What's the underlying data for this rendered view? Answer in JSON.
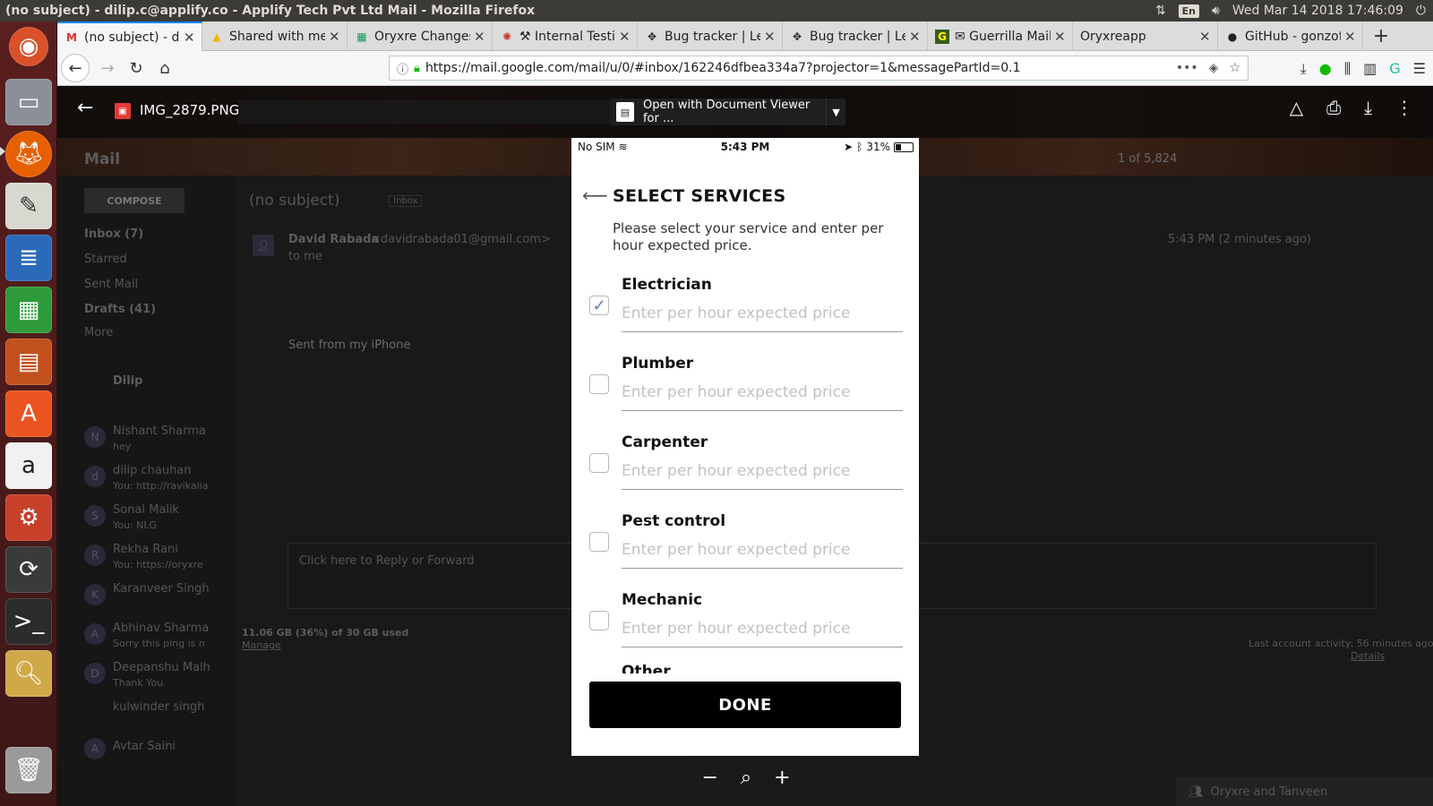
{
  "panel": {
    "window_title": "(no subject) - dilip.c@applify.co - Applify Tech Pvt Ltd Mail - Mozilla Firefox",
    "lang": "En",
    "datetime": "Wed Mar 14 2018 17:46:09"
  },
  "tabs": [
    {
      "label": "(no subject) - dil",
      "icon": "gmail-icon",
      "active": true
    },
    {
      "label": "Shared with me",
      "icon": "drive-icon",
      "active": false
    },
    {
      "label": "Oryxre Changes",
      "icon": "sheets-icon",
      "active": false
    },
    {
      "label": "⚒ Internal Testi",
      "icon": "app-icon",
      "active": false
    },
    {
      "label": "Bug tracker | Le",
      "icon": "bug-icon",
      "active": false
    },
    {
      "label": "Bug tracker | Le",
      "icon": "bug-icon",
      "active": false
    },
    {
      "label": "✉ Guerrilla Mail",
      "icon": "guerrilla-icon",
      "active": false
    },
    {
      "label": "Oryxreapp",
      "icon": "",
      "active": false
    },
    {
      "label": "GitHub - gonzof",
      "icon": "github-icon",
      "active": false
    }
  ],
  "url": "https://mail.google.com/mail/u/0/#inbox/162246dfbea334a7?projector=1&messagePartId=0.1",
  "gmail": {
    "mail_label": "Mail",
    "compose": "COMPOSE",
    "nav": [
      "Inbox (7)",
      "Starred",
      "Sent Mail",
      "Drafts (41)",
      "More"
    ],
    "subject": "(no subject)",
    "inbox_chip": "Inbox",
    "sender": "David Rabada",
    "sender_email": "<davidrabada01@gmail.com>",
    "to": "to me",
    "time": "5:43 PM (2 minutes ago)",
    "body": "Sent from my iPhone",
    "count": "1 of 5,824",
    "reply_prompt": "Click here to Reply or Forward",
    "storage": "11.06 GB (36%) of 30 GB used",
    "manage": "Manage",
    "last_activity": "Last account activity: 56 minutes ago",
    "details": "Details",
    "chat_user": "Dilip",
    "contacts": [
      {
        "name": "Nishant Sharma",
        "msg": "hey"
      },
      {
        "name": "dilip chauhan",
        "msg": "You: http://ravikalia"
      },
      {
        "name": "Sonal Malik",
        "msg": "You: NLG"
      },
      {
        "name": "Rekha Rani",
        "msg": "You: https://oryxre"
      },
      {
        "name": "Karanveer Singh",
        "msg": ""
      },
      {
        "name": "Abhinav Sharma",
        "msg": "Sorry this ping is n"
      },
      {
        "name": "Deepanshu Malh",
        "msg": "Thank You"
      },
      {
        "name": "kulwinder singh",
        "msg": ""
      },
      {
        "name": "Avtar Saini",
        "msg": ""
      }
    ],
    "chat_bar": "Oryxre and Tanveen"
  },
  "viewer": {
    "file_name": "IMG_2879.PNG",
    "open_with": "Open with Document Viewer for ..."
  },
  "phone": {
    "carrier": "No SIM",
    "time": "5:43 PM",
    "battery": "31%",
    "battery_level": 0.31,
    "title": "SELECT SERVICES",
    "subtitle": "Please select your service and enter per hour expected price.",
    "placeholder": "Enter per hour expected price",
    "services": [
      {
        "name": "Electrician",
        "checked": true
      },
      {
        "name": "Plumber",
        "checked": false
      },
      {
        "name": "Carpenter",
        "checked": false
      },
      {
        "name": "Pest control",
        "checked": false
      },
      {
        "name": "Mechanic",
        "checked": false
      }
    ],
    "partial_service": "Other",
    "done": "DONE"
  }
}
